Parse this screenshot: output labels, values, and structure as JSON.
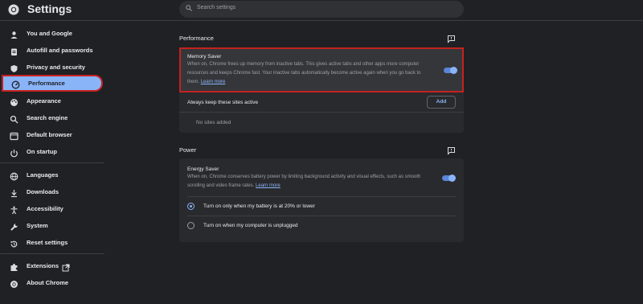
{
  "app": {
    "title": "Settings"
  },
  "search": {
    "placeholder": "Search settings"
  },
  "sidebar": {
    "items": [
      {
        "label": "You and Google",
        "icon": "person-icon"
      },
      {
        "label": "Autofill and passwords",
        "icon": "clipboard-icon"
      },
      {
        "label": "Privacy and security",
        "icon": "shield-icon"
      },
      {
        "label": "Performance",
        "icon": "speedometer-icon",
        "active": true
      },
      {
        "label": "Appearance",
        "icon": "palette-icon"
      },
      {
        "label": "Search engine",
        "icon": "search-icon"
      },
      {
        "label": "Default browser",
        "icon": "browser-icon"
      },
      {
        "label": "On startup",
        "icon": "power-icon"
      },
      {
        "label": "Languages",
        "icon": "globe-icon"
      },
      {
        "label": "Downloads",
        "icon": "download-icon"
      },
      {
        "label": "Accessibility",
        "icon": "accessibility-icon"
      },
      {
        "label": "System",
        "icon": "wrench-icon"
      },
      {
        "label": "Reset settings",
        "icon": "reset-icon"
      },
      {
        "label": "Extensions",
        "icon": "puzzle-icon"
      },
      {
        "label": "About Chrome",
        "icon": "chrome-icon"
      }
    ]
  },
  "performance": {
    "title": "Performance",
    "memory_saver": {
      "title": "Memory Saver",
      "description": "When on, Chrome frees up memory from inactive tabs. This gives active tabs and other apps more computer resources and keeps Chrome fast. Your inactive tabs automatically become active again when you go back to them.",
      "learn_more": "Learn more",
      "enabled": true
    },
    "always_active": {
      "label": "Always keep these sites active",
      "add_label": "Add",
      "empty_text": "No sites added"
    }
  },
  "power": {
    "title": "Power",
    "energy_saver": {
      "title": "Energy Saver",
      "description": "When on, Chrome conserves battery power by limiting background activity and visual effects, such as smooth scrolling and video frame rates.",
      "learn_more": "Learn more",
      "enabled": true
    },
    "options": [
      {
        "label": "Turn on only when my battery is at 20% or lower",
        "selected": true
      },
      {
        "label": "Turn on when my computer is unplugged",
        "selected": false
      }
    ]
  },
  "colors": {
    "accent": "#8ab4f8",
    "highlight_border": "#c5221f",
    "background": "#202124"
  }
}
